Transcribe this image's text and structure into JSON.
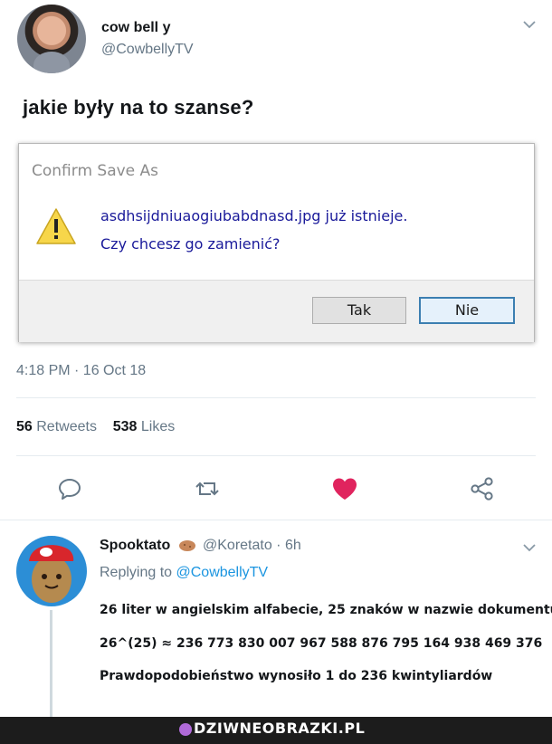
{
  "tweet": {
    "display_name": "cow bell y",
    "handle": "@CowbellyTV",
    "text": "jakie były na to szanse?",
    "timestamp": "4:18 PM · 16 Oct 18",
    "retweets_count": "56",
    "retweets_label": "Retweets",
    "likes_count": "538",
    "likes_label": "Likes",
    "icons": [
      "reply-icon",
      "retweet-icon",
      "heart-icon",
      "share-icon"
    ],
    "heart_color": "#e0245e"
  },
  "dialog": {
    "title": "Confirm Save As",
    "message_line1": "asdhsijdniuaogiubabdnasd.jpg już istnieje.",
    "message_line2": "Czy chcesz go zamienić?",
    "yes_label": "Tak",
    "no_label": "Nie"
  },
  "reply": {
    "display_name": "Spooktato",
    "handle_time": "@Koretato · 6h",
    "replying_prefix": "Replying to",
    "replying_to": "@CowbellyTV",
    "lines": [
      "26 liter w angielskim alfabecie, 25 znaków w nazwie dokumentu",
      "26^(25) ≈ 236 773 830 007 967 588  876 795 164 938 469 376",
      "Prawdopodobieństwo wynosiło 1 do 236 kwintyliardów"
    ]
  },
  "footer": {
    "brand": "DZIWNEOBRAZKI.PL"
  }
}
